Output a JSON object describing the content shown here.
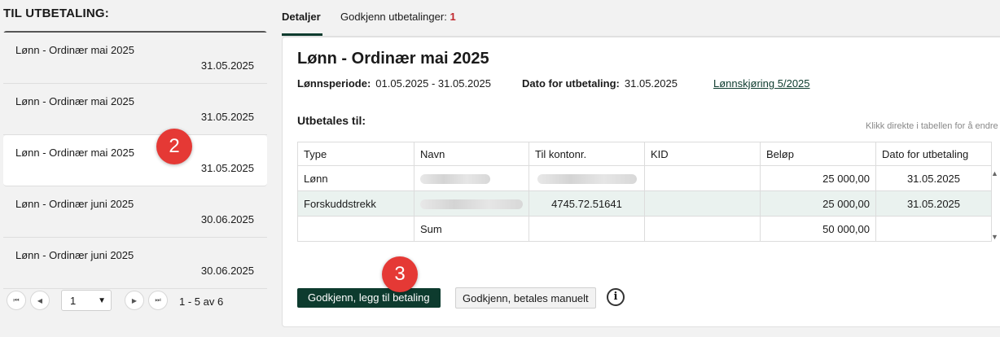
{
  "left": {
    "title": "TIL UTBETALING:",
    "items": [
      {
        "name": "Lønn - Ordinær mai 2025",
        "date": "31.05.2025"
      },
      {
        "name": "Lønn - Ordinær mai 2025",
        "date": "31.05.2025"
      },
      {
        "name": "Lønn - Ordinær mai 2025",
        "date": "31.05.2025"
      },
      {
        "name": "Lønn - Ordinær juni 2025",
        "date": "30.06.2025"
      },
      {
        "name": "Lønn - Ordinær juni 2025",
        "date": "30.06.2025"
      }
    ],
    "pager": {
      "first": "⏮",
      "prev": "◀",
      "next": "▶",
      "last": "⏭",
      "page": "1",
      "info": "1 - 5 av 6"
    }
  },
  "tabs": {
    "details": "Detaljer",
    "approve": "Godkjenn utbetalinger:",
    "approve_count": "1"
  },
  "detail": {
    "title": "Lønn - Ordinær mai 2025",
    "period_label": "Lønnsperiode:",
    "period_value": "01.05.2025 - 31.05.2025",
    "paydate_label": "Dato for utbetaling:",
    "paydate_value": "31.05.2025",
    "run_link": "Lønnskjøring 5/2025",
    "subtitle": "Utbetales til:",
    "hint": "Klikk direkte i tabellen for å endre",
    "table": {
      "headers": [
        "Type",
        "Navn",
        "Til kontonr.",
        "KID",
        "Beløp",
        "Dato for utbetaling"
      ],
      "rows": [
        {
          "type": "Lønn",
          "account": "",
          "kid": "",
          "amount": "25 000,00",
          "date": "31.05.2025"
        },
        {
          "type": "Forskuddstrekk",
          "account": "4745.72.51641",
          "kid": "",
          "amount": "25 000,00",
          "date": "31.05.2025"
        }
      ],
      "sum_label": "Sum",
      "sum_amount": "50 000,00"
    },
    "btn_primary": "Godkjenn, legg til betaling",
    "btn_secondary": "Godkjenn, betales manuelt",
    "info": "i"
  },
  "markers": [
    "2",
    "3"
  ]
}
